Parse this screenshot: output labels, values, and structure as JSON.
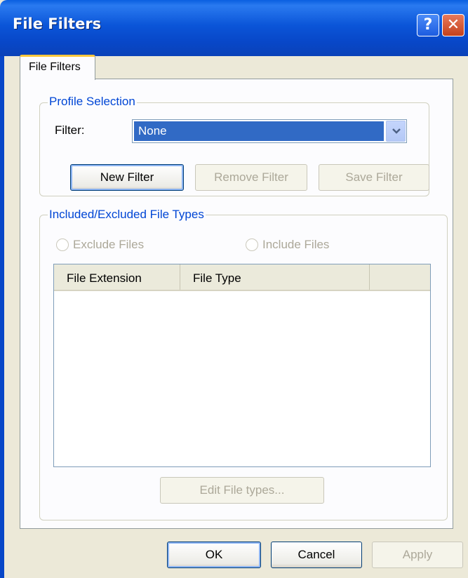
{
  "window": {
    "title": "File Filters",
    "help_icon": "?",
    "close_icon": "✕"
  },
  "tabs": [
    {
      "label": "File Filters",
      "selected": true
    }
  ],
  "profile_selection": {
    "group_label": "Profile Selection",
    "filter_label": "Filter:",
    "filter_value": "None",
    "buttons": {
      "new_filter": "New Filter",
      "remove_filter": "Remove Filter",
      "save_filter": "Save Filter"
    }
  },
  "file_types": {
    "group_label": "Included/Excluded File Types",
    "exclude_label": "Exclude Files",
    "include_label": "Include Files",
    "columns": [
      "File Extension",
      "File Type"
    ],
    "edit_button": "Edit File types..."
  },
  "footer": {
    "ok": "OK",
    "cancel": "Cancel",
    "apply": "Apply"
  },
  "colors": {
    "titlebar": "#0b55d8",
    "group_label": "#0046d5",
    "selection": "#316ac5",
    "disabled_text": "#aca899"
  }
}
